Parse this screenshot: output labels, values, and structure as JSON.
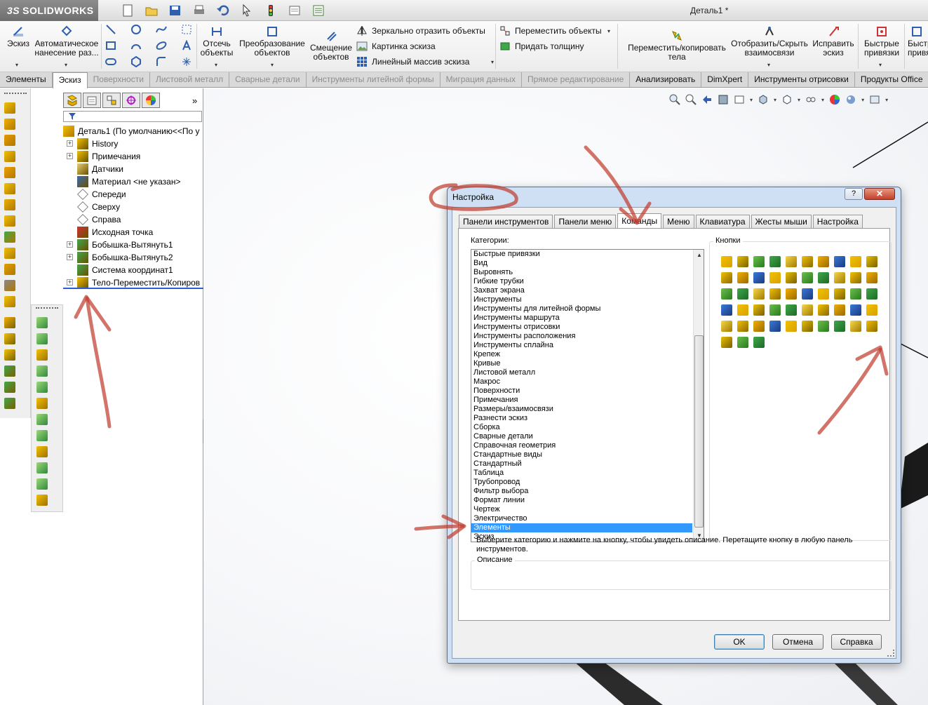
{
  "app": {
    "logo": "SOLIDWORKS",
    "logo_prefix": "3S",
    "document_title": "Деталь1 *"
  },
  "ribbon": {
    "sketch": "Эскиз",
    "auto_dim": "Автоматическое нанесение раз...",
    "trim": "Отсечь объекты",
    "convert": "Преобразование объектов",
    "offset": "Смещение объектов",
    "mirror": "Зеркально отразить объекты",
    "sketch_picture": "Картинка эскиза",
    "linear_pattern": "Линейный массив эскиза",
    "move": "Переместить объекты",
    "thicken": "Придать толщину",
    "move_copy": "Переместить/копировать тела",
    "show_hide": "Отобразить/Скрыть взаимосвязи",
    "repair": "Исправить эскиз",
    "quick_snaps": "Быстрые привязки",
    "quick_snaps_cut": "Быстр привязки"
  },
  "tabs": [
    {
      "label": "Элементы",
      "state": "normal"
    },
    {
      "label": "Эскиз",
      "state": "active"
    },
    {
      "label": "Поверхности",
      "state": "disabled"
    },
    {
      "label": "Листовой металл",
      "state": "disabled"
    },
    {
      "label": "Сварные детали",
      "state": "disabled"
    },
    {
      "label": "Инструменты литейной формы",
      "state": "disabled"
    },
    {
      "label": "Миграция данных",
      "state": "disabled"
    },
    {
      "label": "Прямое редактирование",
      "state": "disabled"
    },
    {
      "label": "Анализировать",
      "state": "normal"
    },
    {
      "label": "DimXpert",
      "state": "normal"
    },
    {
      "label": "Инструменты отрисовки",
      "state": "normal"
    },
    {
      "label": "Продукты Office",
      "state": "normal"
    }
  ],
  "tree": {
    "more": "»",
    "root": "Деталь1  (По умолчанию<<По у",
    "items": [
      {
        "label": "History",
        "expand": true
      },
      {
        "label": "Примечания",
        "expand": true
      },
      {
        "label": "Датчики",
        "expand": false
      },
      {
        "label": "Материал <не указан>",
        "expand": false
      },
      {
        "label": "Спереди",
        "expand": false
      },
      {
        "label": "Сверху",
        "expand": false
      },
      {
        "label": "Справа",
        "expand": false
      },
      {
        "label": "Исходная точка",
        "expand": false
      },
      {
        "label": "Бобышка-Вытянуть1",
        "expand": true
      },
      {
        "label": "Бобышка-Вытянуть2",
        "expand": true
      },
      {
        "label": "Система координат1",
        "expand": false
      },
      {
        "label": "Тело-Переместить/Копиров",
        "expand": true
      }
    ]
  },
  "dialog": {
    "title": "Настройка",
    "help": "?",
    "close": "✕",
    "tabs": [
      "Панели инструментов",
      "Панели меню",
      "Команды",
      "Меню",
      "Клавиатура",
      "Жесты мыши",
      "Настройка"
    ],
    "active_tab": "Команды",
    "categories_label": "Категории:",
    "categories": [
      "Быстрые привязки",
      "Вид",
      "Выровнять",
      "Гибкие трубки",
      "Захват экрана",
      "Инструменты",
      "Инструменты для литейной формы",
      "Инструменты маршрута",
      "Инструменты отрисовки",
      "Инструменты расположения",
      "Инструменты сплайна",
      "Крепеж",
      "Кривые",
      "Листовой металл",
      "Макрос",
      "Поверхности",
      "Примечания",
      "Размеры/взаимосвязи",
      "Разнести эскиз",
      "Сборка",
      "Сварные детали",
      "Справочная геометрия",
      "Стандартные виды",
      "Стандартный",
      "Таблица",
      "Трубопровод",
      "Фильтр выбора",
      "Формат линии",
      "Чертеж",
      "Электричество",
      "Элементы",
      "Эскиз"
    ],
    "selected_category": "Элементы",
    "buttons_label": "Кнопки",
    "hint": "Выберите категорию и нажмите на кнопку, чтобы увидеть описание. Перетащите кнопку в любую панель инструментов.",
    "description_label": "Описание",
    "ok": "OK",
    "cancel": "Отмена",
    "help_button": "Справка"
  },
  "colors": {
    "accent_selection": "#3399ff",
    "annotation": "#c0392b",
    "icon_yellow": "#f2c200",
    "icon_green": "#3fa84a"
  }
}
